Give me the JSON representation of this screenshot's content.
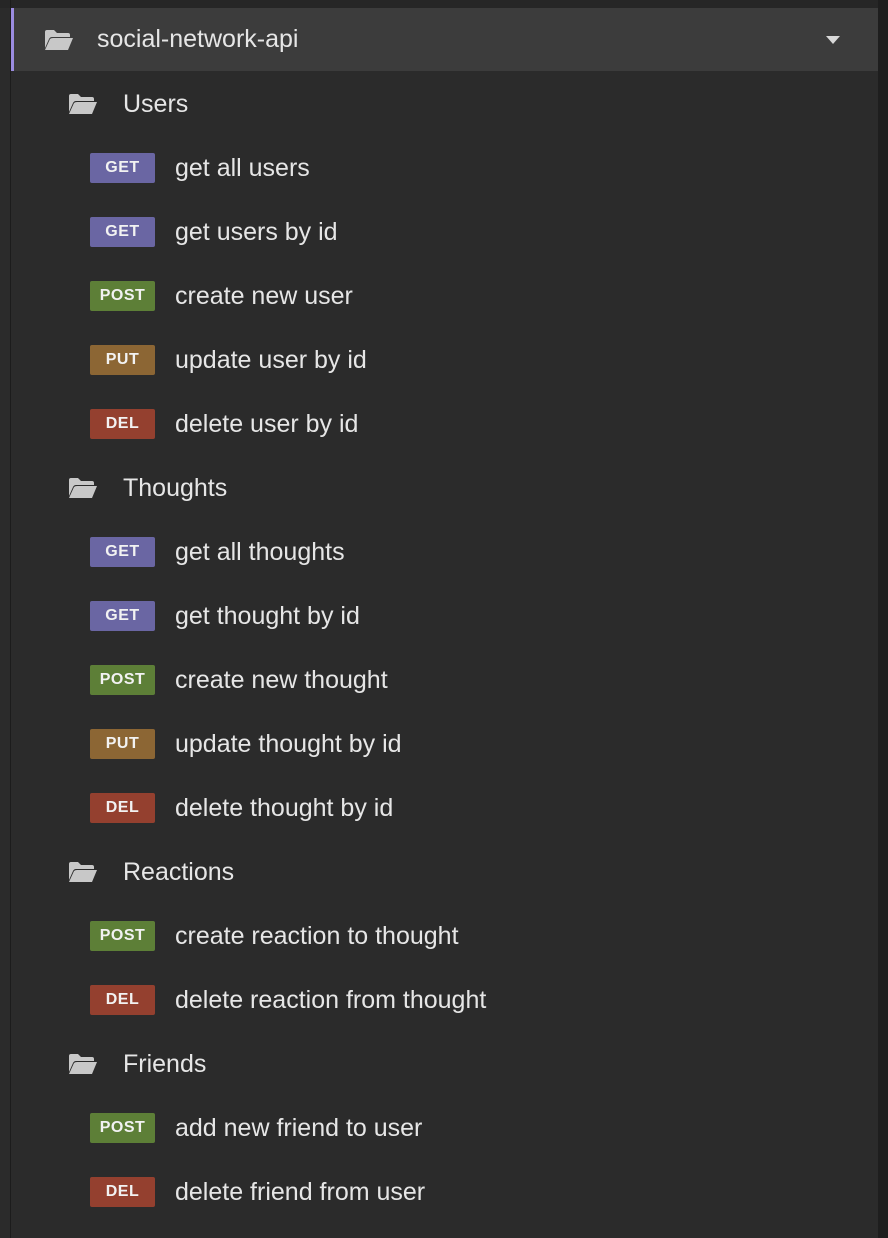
{
  "collection": {
    "name": "social-network-api",
    "expanded": true,
    "icons": {
      "folder": "folder-open-icon",
      "caret": "caret-down-icon"
    }
  },
  "method_colors": {
    "GET": "#6a66a3",
    "POST": "#5d7f37",
    "PUT": "#8c6634",
    "DEL": "#94402f"
  },
  "folders": [
    {
      "name": "Users",
      "requests": [
        {
          "method": "GET",
          "name": "get all users"
        },
        {
          "method": "GET",
          "name": "get users by id"
        },
        {
          "method": "POST",
          "name": "create new user"
        },
        {
          "method": "PUT",
          "name": "update user by id"
        },
        {
          "method": "DEL",
          "name": "delete user by id"
        }
      ]
    },
    {
      "name": "Thoughts",
      "requests": [
        {
          "method": "GET",
          "name": "get all thoughts"
        },
        {
          "method": "GET",
          "name": "get thought by id"
        },
        {
          "method": "POST",
          "name": "create new thought"
        },
        {
          "method": "PUT",
          "name": "update thought by id"
        },
        {
          "method": "DEL",
          "name": "delete thought by id"
        }
      ]
    },
    {
      "name": "Reactions",
      "requests": [
        {
          "method": "POST",
          "name": "create reaction to thought"
        },
        {
          "method": "DEL",
          "name": "delete reaction from thought"
        }
      ]
    },
    {
      "name": "Friends",
      "requests": [
        {
          "method": "POST",
          "name": "add new friend to user"
        },
        {
          "method": "DEL",
          "name": "delete friend from user"
        }
      ]
    }
  ]
}
